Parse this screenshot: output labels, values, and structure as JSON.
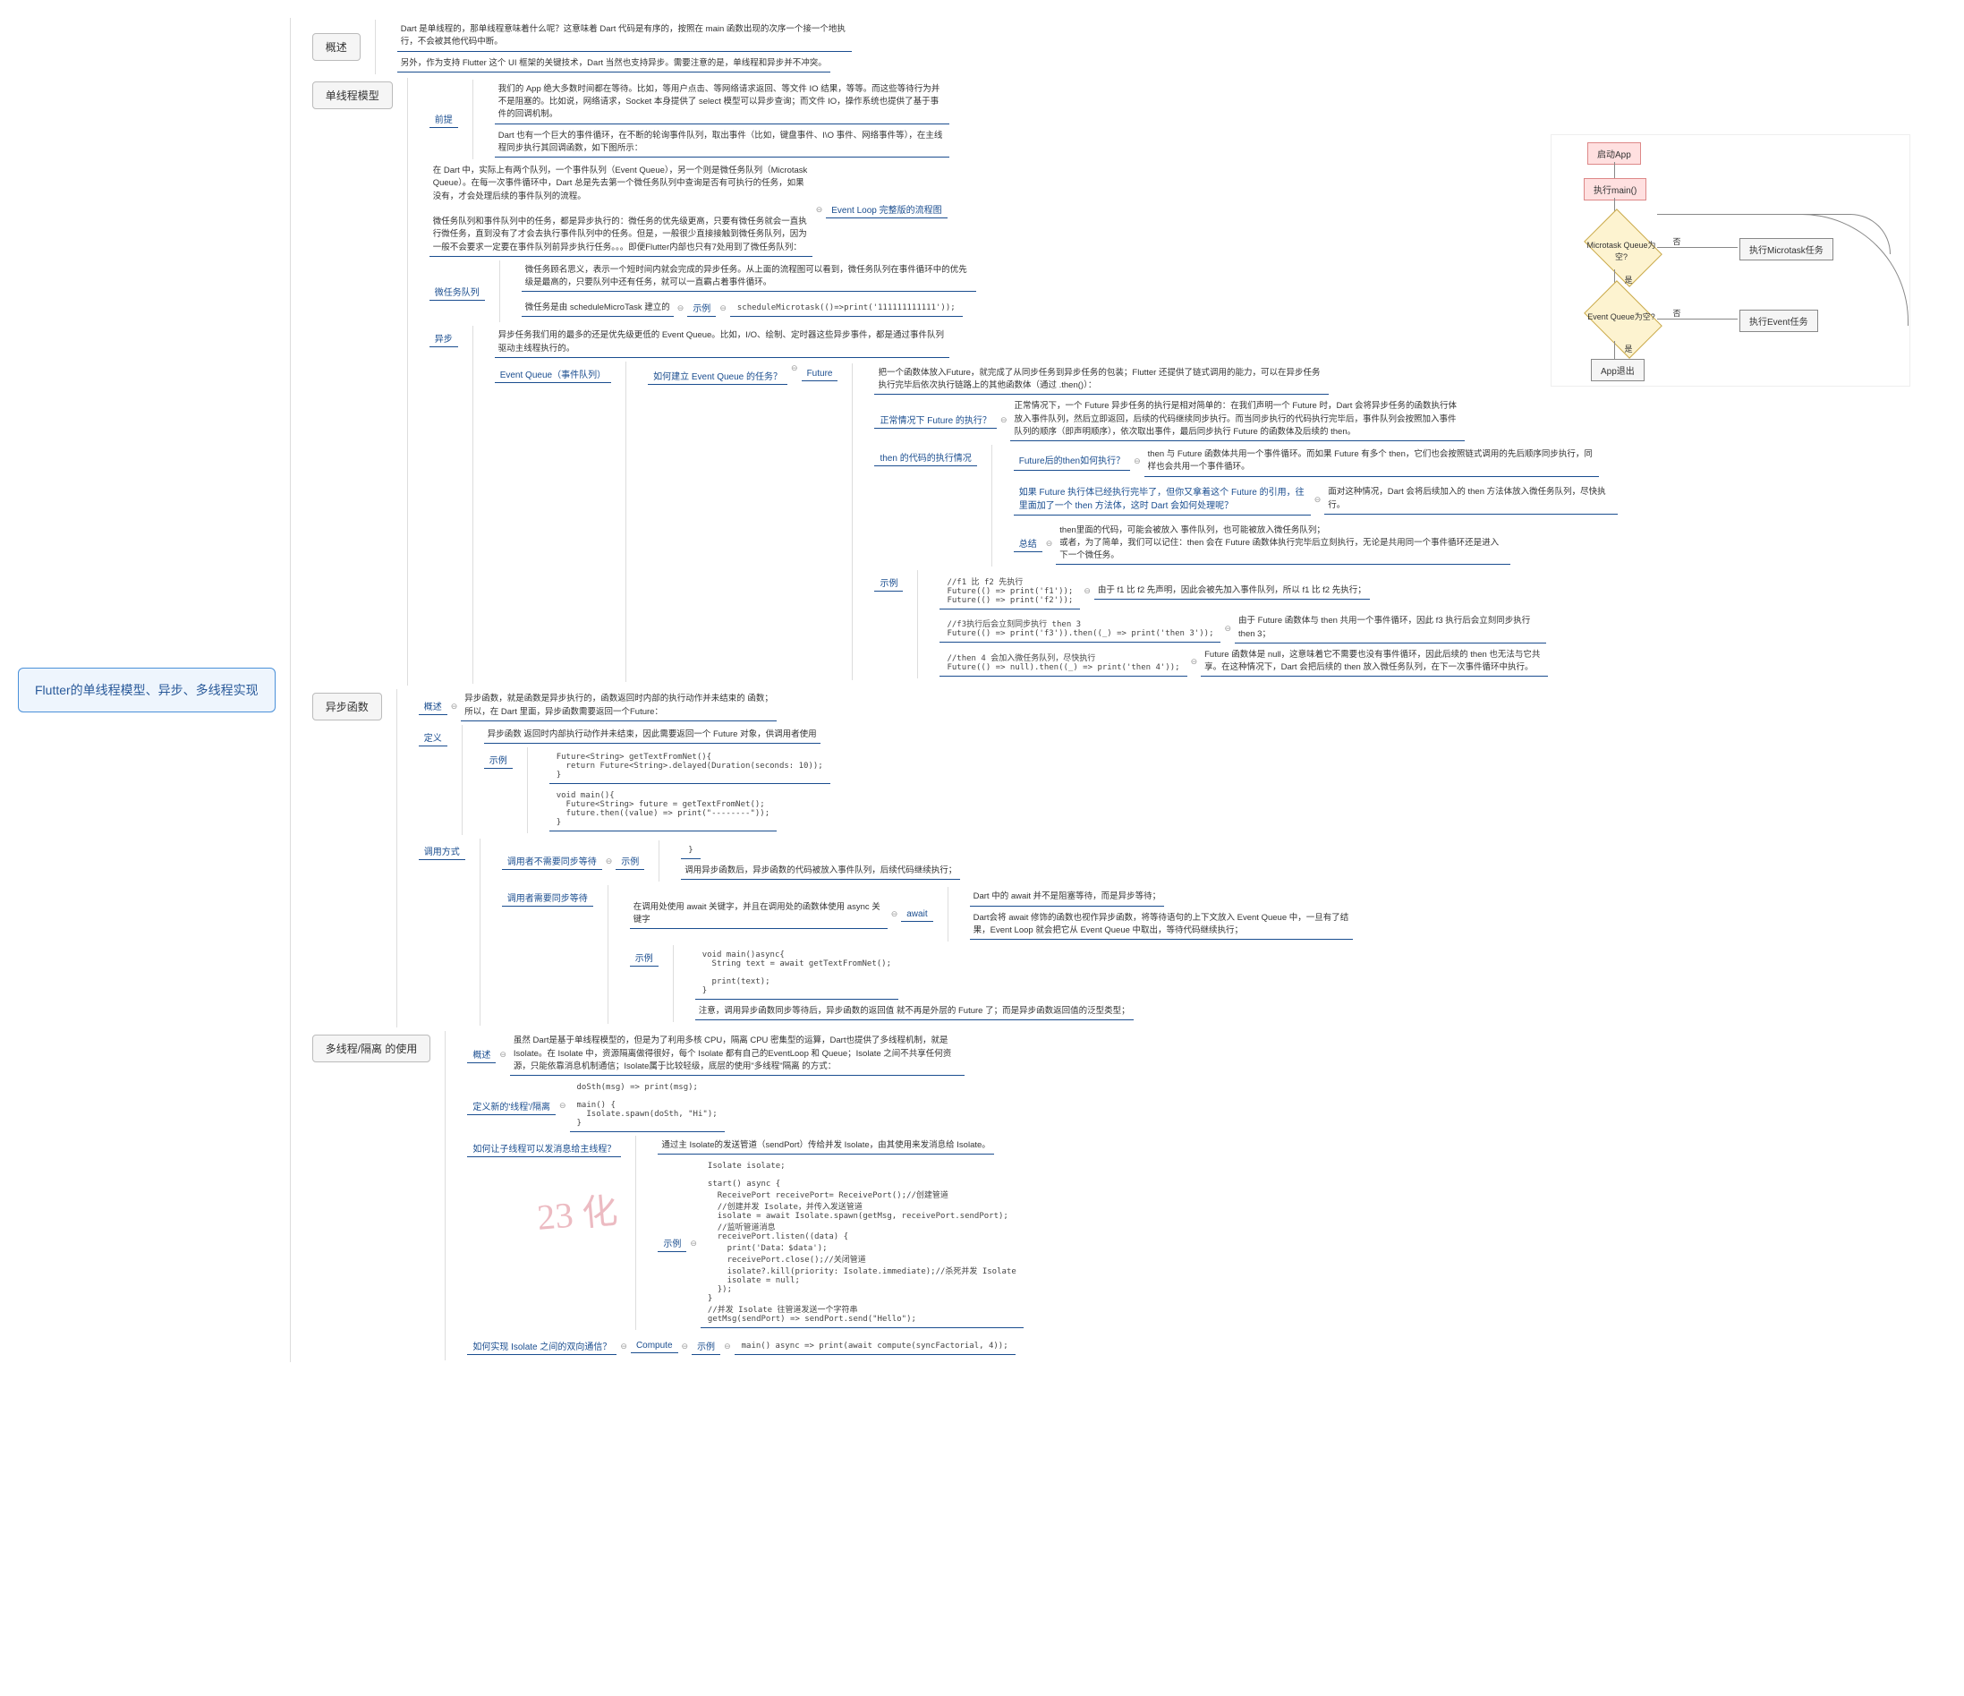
{
  "root": "Flutter的单线程模型、异步、多线程实现",
  "overview": {
    "label": "概述",
    "p1": "Dart 是单线程的，那单线程意味着什么呢？这意味着 Dart 代码是有序的，按照在 main 函数出现的次序一个接一个地执行，不会被其他代码中断。",
    "p2": "另外，作为支持 Flutter 这个 UI 框架的关键技术，Dart 当然也支持异步。需要注意的是，单线程和异步并不冲突。"
  },
  "single": {
    "label": "单线程模型",
    "pre_label": "前提",
    "pre_p1": "我们的 App 绝大多数时间都在等待。比如，等用户点击、等网络请求返回、等文件 IO 结果，等等。而这些等待行为并不是阻塞的。比如说，网络请求，Socket 本身提供了 select 模型可以异步查询；而文件 IO，操作系统也提供了基于事件的回调机制。",
    "pre_p2": "Dart 也有一个巨大的事件循环，在不断的轮询事件队列，取出事件（比如，键盘事件、I\\O 事件、网络事件等），在主线程同步执行其回调函数，如下图所示：",
    "intro": "在 Dart 中，实际上有两个队列，一个事件队列（Event Queue），另一个则是微任务队列（Microtask Queue）。在每一次事件循环中，Dart 总是先去第一个微任务队列中查询是否有可执行的任务，如果没有，才会处理后续的事件队列的流程。\n\n微任务队列和事件队列中的任务，都是异步执行的：微任务的优先级更高，只要有微任务就会一直执行微任务，直到没有了才会去执行事件队列中的任务。但是，一般很少直接接触到微任务队列，因为一般不会要求一定要在事件队列前异步执行任务。。。即便Flutter内部也只有7处用到了微任务队列：",
    "eventloop_caption": "Event Loop 完整版的流程图",
    "micro_label": "微任务队列",
    "micro_p1": "微任务顾名思义，表示一个短时间内就会完成的异步任务。从上面的流程图可以看到，微任务队列在事件循环中的优先级是最高的，只要队列中还有任务，就可以一直霸占着事件循环。",
    "micro_p2": "微任务是由 scheduleMicroTask 建立的",
    "micro_example_label": "示例",
    "micro_code": "scheduleMicrotask(()=>print('111111111111'));",
    "async_label": "异步",
    "event_intro": "异步任务我们用的最多的还是优先级更低的 Event Queue。比如，I/O、绘制、定时器这些异步事件，都是通过事件队列驱动主线程执行的。",
    "event_label": "Event Queue（事件队列）",
    "howto_label": "如何建立 Event Queue 的任务？",
    "future_label": "Future",
    "future_p1": "把一个函数体放入Future，就完成了从同步任务到异步任务的包装；Flutter 还提供了链式调用的能力，可以在异步任务执行完毕后依次执行链路上的其他函数体（通过 .then()）：",
    "normal_label": "正常情况下 Future 的执行？",
    "normal_text": "正常情况下，一个 Future 异步任务的执行是相对简单的：在我们声明一个 Future 时，Dart 会将异步任务的函数执行体放入事件队列，然后立即返回，后续的代码继续同步执行。而当同步执行的代码执行完毕后，事件队列会按照加入事件队列的顺序（即声明顺序），依次取出事件，最后同步执行 Future 的函数体及后续的 then。",
    "then_label": "then 的代码的执行情况",
    "then_q1": "Future后的then如何执行？",
    "then_a1": "then 与 Future 函数体共用一个事件循环。而如果 Future 有多个 then，它们也会按照链式调用的先后顺序同步执行，同样也会共用一个事件循环。",
    "then_q2": "如果 Future 执行体已经执行完毕了，但你又拿着这个 Future 的引用，往里面加了一个 then 方法体，这时 Dart 会如何处理呢？",
    "then_a2": "面对这种情况，Dart 会将后续加入的 then 方法体放入微任务队列，尽快执行。",
    "conclusion_label": "总结",
    "conclusion_text": "then里面的代码，可能会被放入 事件队列，也可能被放入微任务队列；\n或者，为了简单，我们可以记住：then 会在 Future 函数体执行完毕后立刻执行，无论是共用同一个事件循环还是进入下一个微任务。",
    "examples_label": "示例",
    "ex1_code": "//f1 比 f2 先执行\nFuture(() => print('f1'));\nFuture(() => print('f2'));",
    "ex1_note": "由于 f1 比 f2 先声明，因此会被先加入事件队列，所以 f1 比 f2 先执行；",
    "ex2_code": "//f3执行后会立刻同步执行 then 3\nFuture(() => print('f3')).then((_) => print('then 3'));",
    "ex2_note": "由于 Future 函数体与 then 共用一个事件循环，因此 f3 执行后会立刻同步执行 then 3；",
    "ex3_code": "//then 4 会加入微任务队列，尽快执行\nFuture(() => null).then((_) => print('then 4'));",
    "ex3_note": "Future 函数体是 null，这意味着它不需要也没有事件循环，因此后续的 then 也无法与它共享。在这种情况下，Dart 会把后续的 then 放入微任务队列，在下一次事件循环中执行。"
  },
  "asyncfn": {
    "label": "异步函数",
    "ov_label": "概述",
    "ov_text": "异步函数，就是函数是异步执行的，函数返回时内部的执行动作并未结束的 函数；\n所以，在 Dart 里面，异步函数需要返回一个Future：",
    "def_label": "定义",
    "def_text": "异步函数 返回时内部执行动作并未结束，因此需要返回一个 Future 对象，供调用者使用",
    "def_code": "Future<String> getTextFromNet(){\n  return Future<String>.delayed(Duration(seconds: 10));\n}",
    "def_call_code": "void main(){\n  Future<String> future = getTextFromNet();\n  future.then((value) => print(\"--------\"));\n}",
    "call_label": "调用方式",
    "nowait_label": "调用者不需要同步等待",
    "nowait_ex": "示例",
    "nowait_note": "调用异步函数后，异步函数的代码被放入事件队列，后续代码继续执行；",
    "wait_label": "调用者需要同步等待",
    "wait_text": "在调用处使用 await 关键字，并且在调用处的函数体使用 async 关键字",
    "await_label": "await",
    "await_p1": "Dart 中的 await 并不是阻塞等待，而是异步等待；",
    "await_p2": "Dart会将 await 修饰的函数也视作异步函数，将等待语句的上下文放入 Event Queue 中，一旦有了结果，Event Loop 就会把它从 Event Queue 中取出，等待代码继续执行；",
    "wait_code": "void main()async{\n  String text = await getTextFromNet();\n\n  print(text);\n}",
    "wait_note": "注意，调用异步函数同步等待后，异步函数的返回值 就不再是外层的 Future 了；而是异步函数返回值的泛型类型；",
    "ex_label": "示例"
  },
  "isolate": {
    "label": "多线程/隔离 的使用",
    "ov_label": "概述",
    "ov_text": "虽然 Dart是基于单线程模型的，但是为了利用多核 CPU，隔离 CPU 密集型的运算，Dart也提供了多线程机制，就是 Isolate。在 Isolate 中，资源隔离做得很好，每个 Isolate 都有自己的EventLoop 和 Queue；Isolate 之间不共享任何资源，只能依靠消息机制通信；Isolate属于比较轻级，底层的使用\"多线程\"隔离 的方式：",
    "new_label": "定义新的'线程'/隔离",
    "new_code": "doSth(msg) => print(msg);\n\nmain() {\n  Isolate.spawn(doSth, \"Hi\");\n}",
    "back_label": "如何让子线程可以发消息给主线程？",
    "back_text": "通过主 Isolate的发送管道（sendPort）传给并发 Isolate，由其使用来发消息给 Isolate。",
    "back_code": "Isolate isolate;\n\nstart() async {\n  ReceivePort receivePort= ReceivePort();//创建管道\n  //创建并发 Isolate，并传入发送管道\n  isolate = await Isolate.spawn(getMsg, receivePort.sendPort);\n  //监听管道消息\n  receivePort.listen((data) {\n    print('Data：$data');\n    receivePort.close();//关闭管道\n    isolate?.kill(priority: Isolate.immediate);//杀死并发 Isolate\n    isolate = null;\n  });\n}\n//并发 Isolate 往管道发送一个字符串\ngetMsg(sendPort) => sendPort.send(\"Hello\");",
    "back_ex_label": "示例",
    "bi_label": "如何实现 Isolate 之间的双向通信？",
    "compute_label": "Compute",
    "bi_ex_label": "示例",
    "bi_code": "main() async => print(await compute(syncFactorial, 4));"
  },
  "flowchart": {
    "start": "启动App",
    "main": "执行main()",
    "micro_q": "Microtask\nQueue为空?",
    "event_q": "Event\nQueue为空?",
    "run_micro": "执行Microtask任务",
    "run_event": "执行Event任务",
    "exit": "App退出",
    "no": "否",
    "yes": "是"
  },
  "watermark": "23 化"
}
